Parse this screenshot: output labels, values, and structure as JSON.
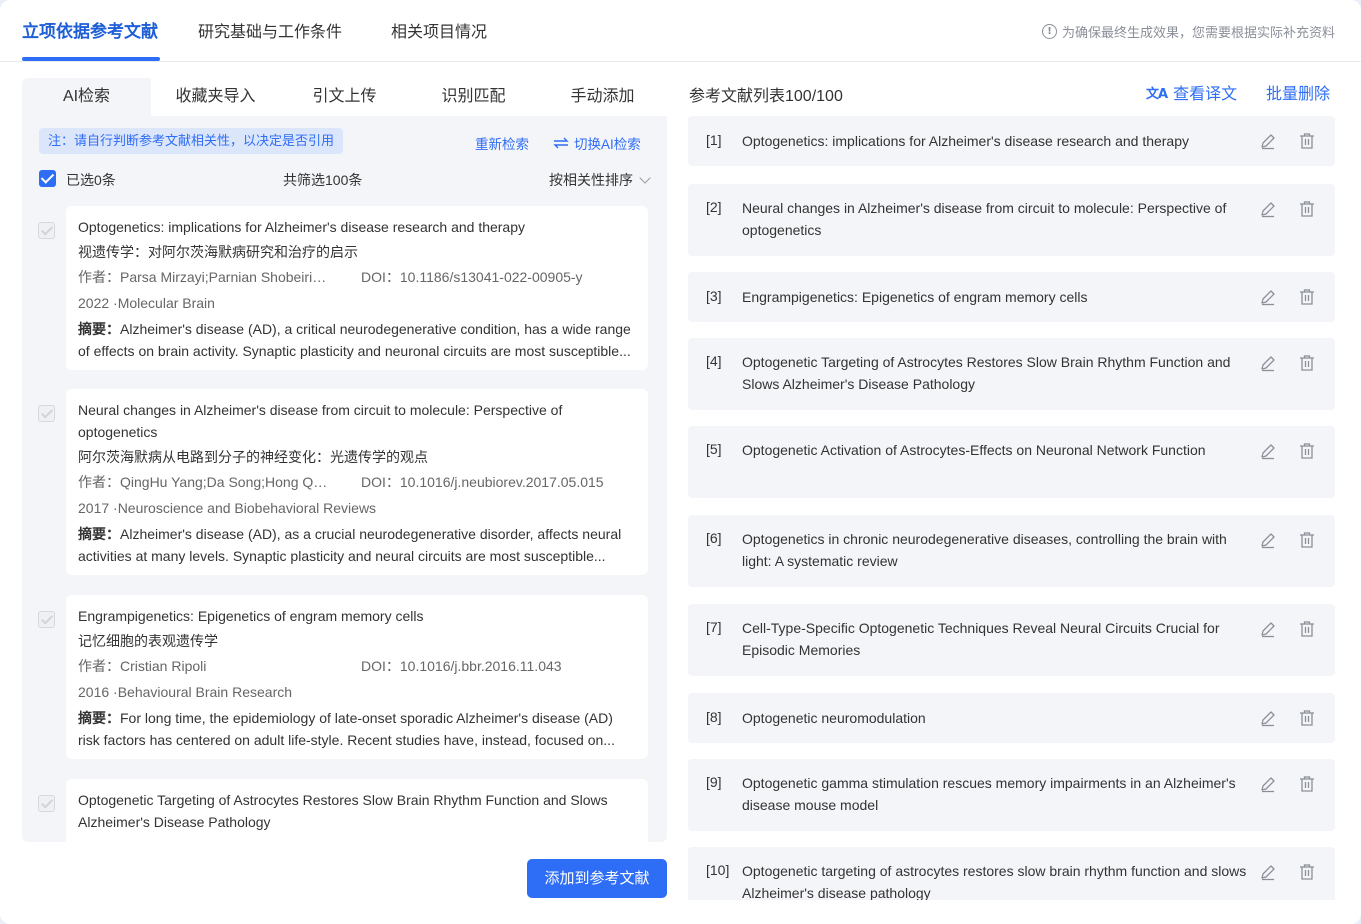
{
  "top_tabs": [
    {
      "label": "立项依据参考文献",
      "active": true
    },
    {
      "label": "研究基础与工作条件",
      "active": false
    },
    {
      "label": "相关项目情况",
      "active": false
    }
  ],
  "top_notice": "为确保最终生成效果，您需要根据实际补充资料",
  "sub_tabs": [
    {
      "label": "AI检索",
      "active": true
    },
    {
      "label": "收藏夹导入",
      "active": false
    },
    {
      "label": "引文上传",
      "active": false
    },
    {
      "label": "识别匹配",
      "active": false
    },
    {
      "label": "手动添加",
      "active": false
    }
  ],
  "notice": "注：请自行判断参考文献相关性，以决定是否引用",
  "research_again": "重新检索",
  "switch_ai": "切换AI检索",
  "selected_label": "已选0条",
  "total_label": "共筛选100条",
  "sort_label": "按相关性排序",
  "labels": {
    "author": "作者：",
    "doi": "DOI：",
    "abstract": "摘要："
  },
  "results": [
    {
      "title": "Optogenetics: implications for Alzheimer's disease research and therapy",
      "title_cn": "视遗传学：对阿尔茨海默病研究和治疗的启示",
      "authors": "Parsa Mirzayi;Parnian Shobeiri…",
      "doi": "10.1186/s13041-022-00905-y",
      "year_journal": "2022 ·Molecular Brain",
      "abstract": "Alzheimer's disease (AD), a critical neurodegenerative condition, has a wide range of effects on brain activity. Synaptic plasticity and neuronal circuits are most susceptible..."
    },
    {
      "title": "Neural changes in Alzheimer's disease from circuit to molecule: Perspective of optogenetics",
      "title_cn": "阿尔茨海默病从电路到分子的神经变化：光遗传学的观点",
      "authors": "QingHu Yang;Da Song;Hong Q…",
      "doi": "10.1016/j.neubiorev.2017.05.015",
      "year_journal": "2017 ·Neuroscience and Biobehavioral Reviews",
      "abstract": "Alzheimer's disease (AD), as a crucial neurodegenerative disorder, affects neural activities at many levels. Synaptic plasticity and neural circuits are most susceptible..."
    },
    {
      "title": "Engrampigenetics: Epigenetics of engram memory cells",
      "title_cn": "记忆细胞的表观遗传学",
      "authors": "Cristian Ripoli",
      "doi": "10.1016/j.bbr.2016.11.043",
      "year_journal": "2016 ·Behavioural Brain Research",
      "abstract": "For long time, the epidemiology of late-onset sporadic Alzheimer's disease (AD) risk factors has centered on adult life-style. Recent studies have, instead, focused on..."
    },
    {
      "title": "Optogenetic Targeting of Astrocytes Restores Slow Brain Rhythm Function and Slows Alzheimer's Disease Pathology",
      "title_cn": "",
      "authors": "",
      "doi": "",
      "year_journal": "",
      "abstract": ""
    }
  ],
  "add_button": "添加到参考文献",
  "ref_list_title": "参考文献列表100/100",
  "view_translation": "查看译文",
  "batch_delete": "批量删除",
  "references": [
    {
      "num": "[1]",
      "title": "Optogenetics: implications for Alzheimer's disease research and therapy"
    },
    {
      "num": "[2]",
      "title": "Neural changes in Alzheimer's disease from circuit to molecule: Perspective of optogenetics"
    },
    {
      "num": "[3]",
      "title": "Engrampigenetics: Epigenetics of engram memory cells"
    },
    {
      "num": "[4]",
      "title": "Optogenetic Targeting of Astrocytes Restores Slow Brain Rhythm Function and Slows Alzheimer's Disease Pathology"
    },
    {
      "num": "[5]",
      "title": "Optogenetic Activation of Astrocytes-Effects on Neuronal Network Function"
    },
    {
      "num": "[6]",
      "title": "Optogenetics in chronic neurodegenerative diseases, controlling the brain with light: A systematic review"
    },
    {
      "num": "[7]",
      "title": "Cell-Type-Specific Optogenetic Techniques Reveal Neural Circuits Crucial for Episodic Memories"
    },
    {
      "num": "[8]",
      "title": "Optogenetic neuromodulation"
    },
    {
      "num": "[9]",
      "title": "Optogenetic gamma stimulation rescues memory impairments in an Alzheimer's disease mouse model"
    },
    {
      "num": "[10]",
      "title": "Optogenetic targeting of astrocytes restores slow brain rhythm function and slows Alzheimer's disease pathology"
    }
  ],
  "colors": {
    "accent": "#2e6df5",
    "panel": "#f4f5f8",
    "notice_bg": "#dce6fb"
  }
}
